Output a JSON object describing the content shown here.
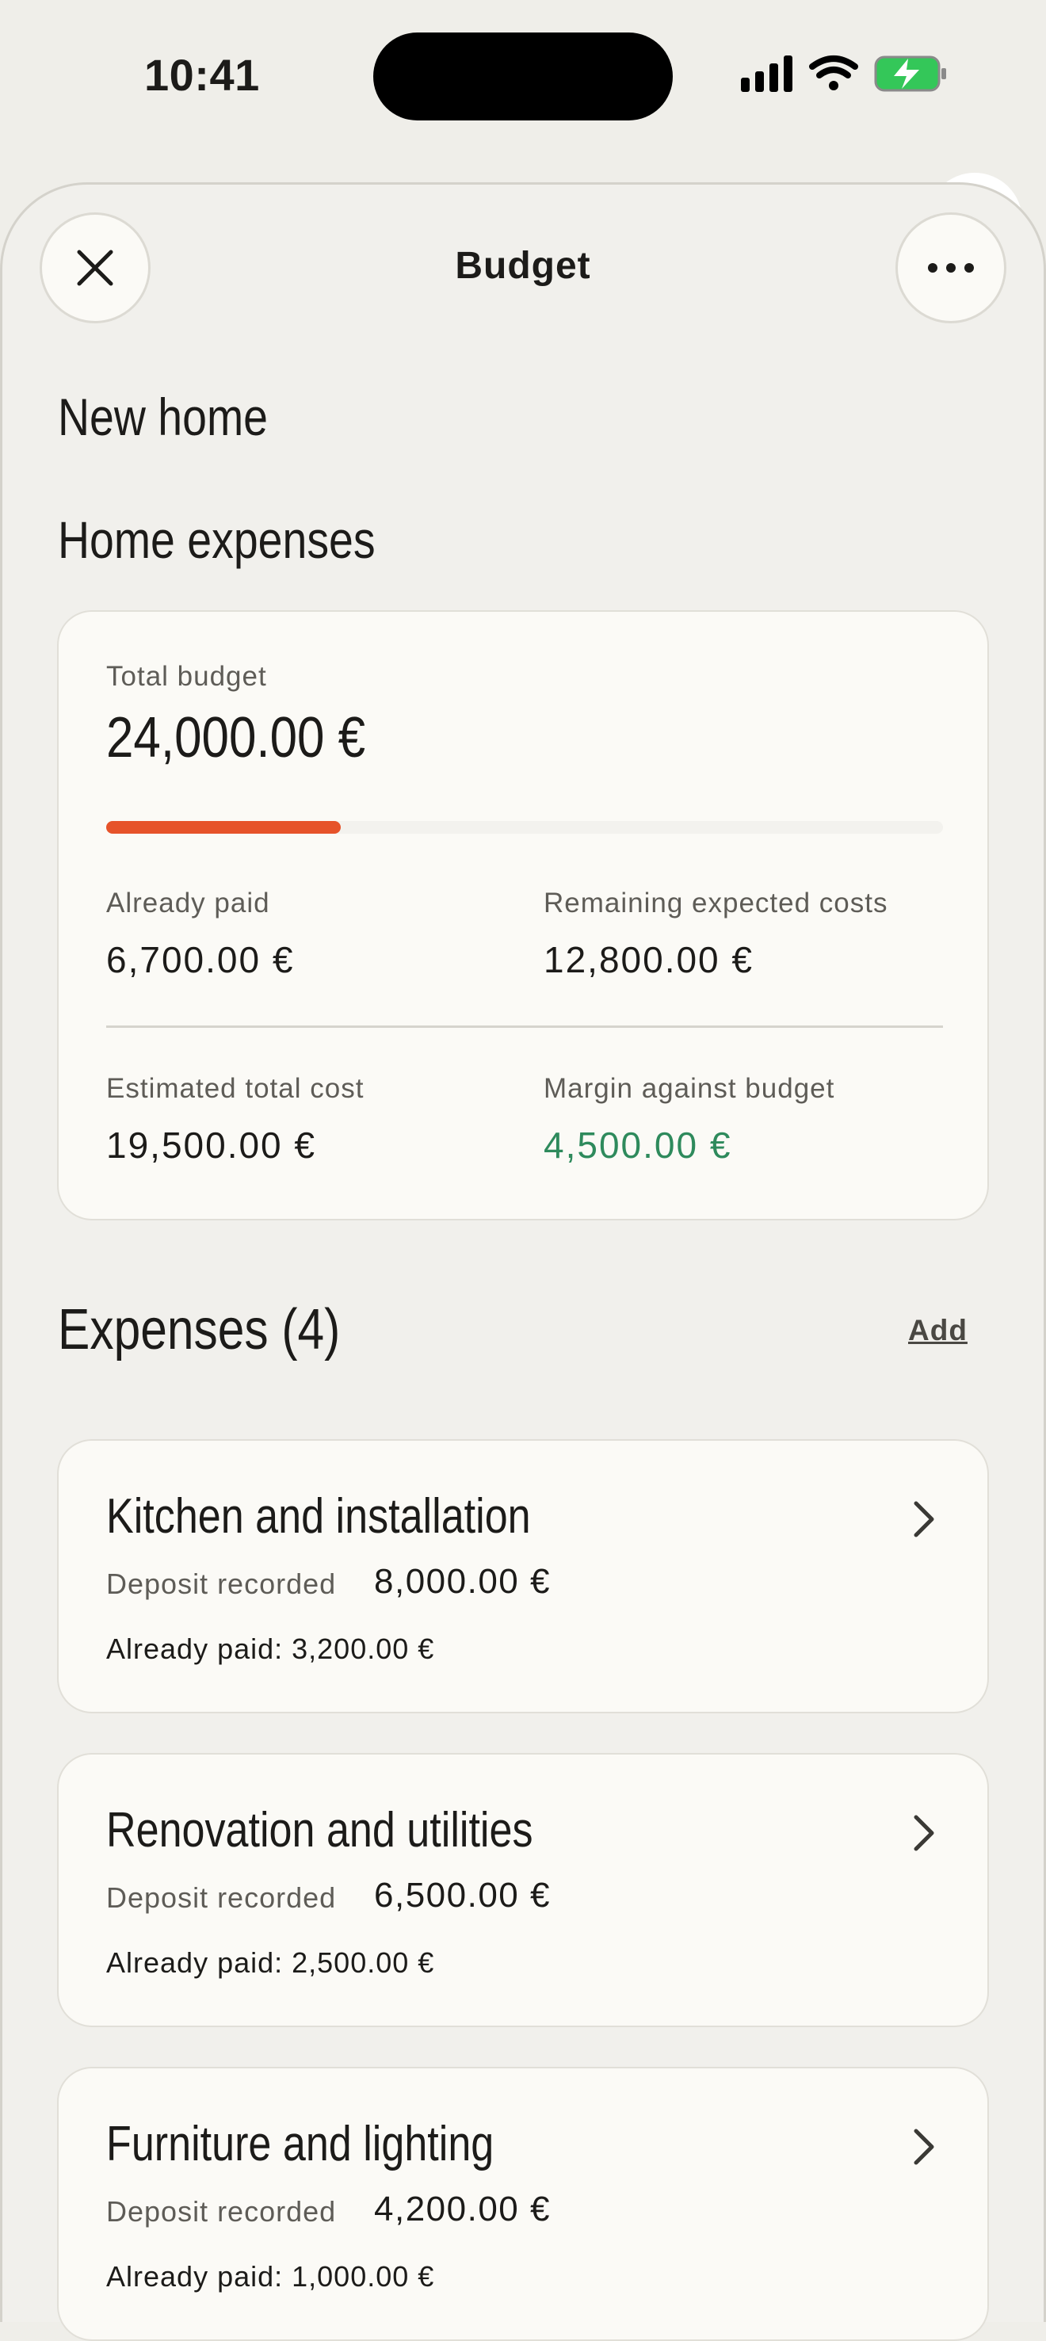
{
  "status_bar": {
    "time": "10:41"
  },
  "nav": {
    "title": "Budget"
  },
  "project": {
    "name": "New home"
  },
  "section": {
    "title": "Home expenses"
  },
  "summary": {
    "total_budget_label": "Total budget",
    "total_budget_value": "24,000.00 €",
    "progress_fraction": 0.28,
    "already_paid_label": "Already paid",
    "already_paid_value": "6,700.00 €",
    "remaining_label": "Remaining expected costs",
    "remaining_value": "12,800.00 €",
    "estimated_label": "Estimated total cost",
    "estimated_value": "19,500.00 €",
    "margin_label": "Margin against budget",
    "margin_value": "4,500.00 €"
  },
  "expenses": {
    "title": "Expenses (4)",
    "add_label": "Add",
    "items": [
      {
        "title": "Kitchen and installation",
        "deposit_label": "Deposit recorded",
        "deposit_value": "8,000.00 €",
        "paid": "Already paid: 3,200.00 €"
      },
      {
        "title": "Renovation and utilities",
        "deposit_label": "Deposit recorded",
        "deposit_value": "6,500.00 €",
        "paid": "Already paid: 2,500.00 €"
      },
      {
        "title": "Furniture and lighting",
        "deposit_label": "Deposit recorded",
        "deposit_value": "4,200.00 €",
        "paid": "Already paid: 1,000.00 €"
      }
    ]
  },
  "colors": {
    "accent": "#e6532a",
    "positive": "#2e8a5c",
    "battery": "#34c759"
  },
  "icons": [
    "signal-icon",
    "wifi-icon",
    "battery-charging-icon",
    "close-icon",
    "more-icon",
    "chevron-right-icon"
  ]
}
